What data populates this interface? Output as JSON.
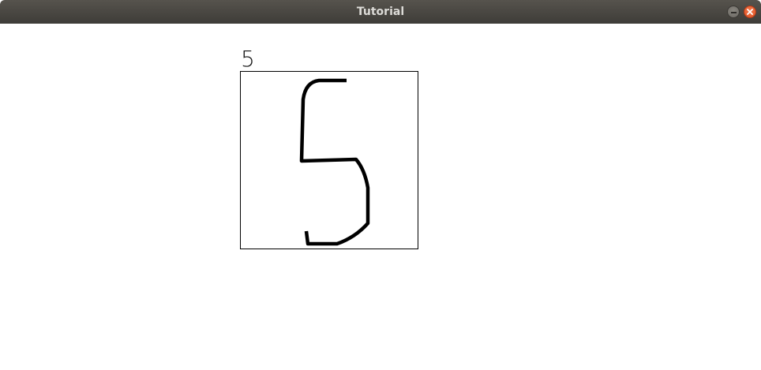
{
  "window": {
    "title": "Tutorial"
  },
  "controls": {
    "minimize": "minimize-icon",
    "close": "close-icon"
  },
  "canvas": {
    "prediction": "5",
    "stroke_color": "#000000",
    "background_color": "#ffffff"
  }
}
